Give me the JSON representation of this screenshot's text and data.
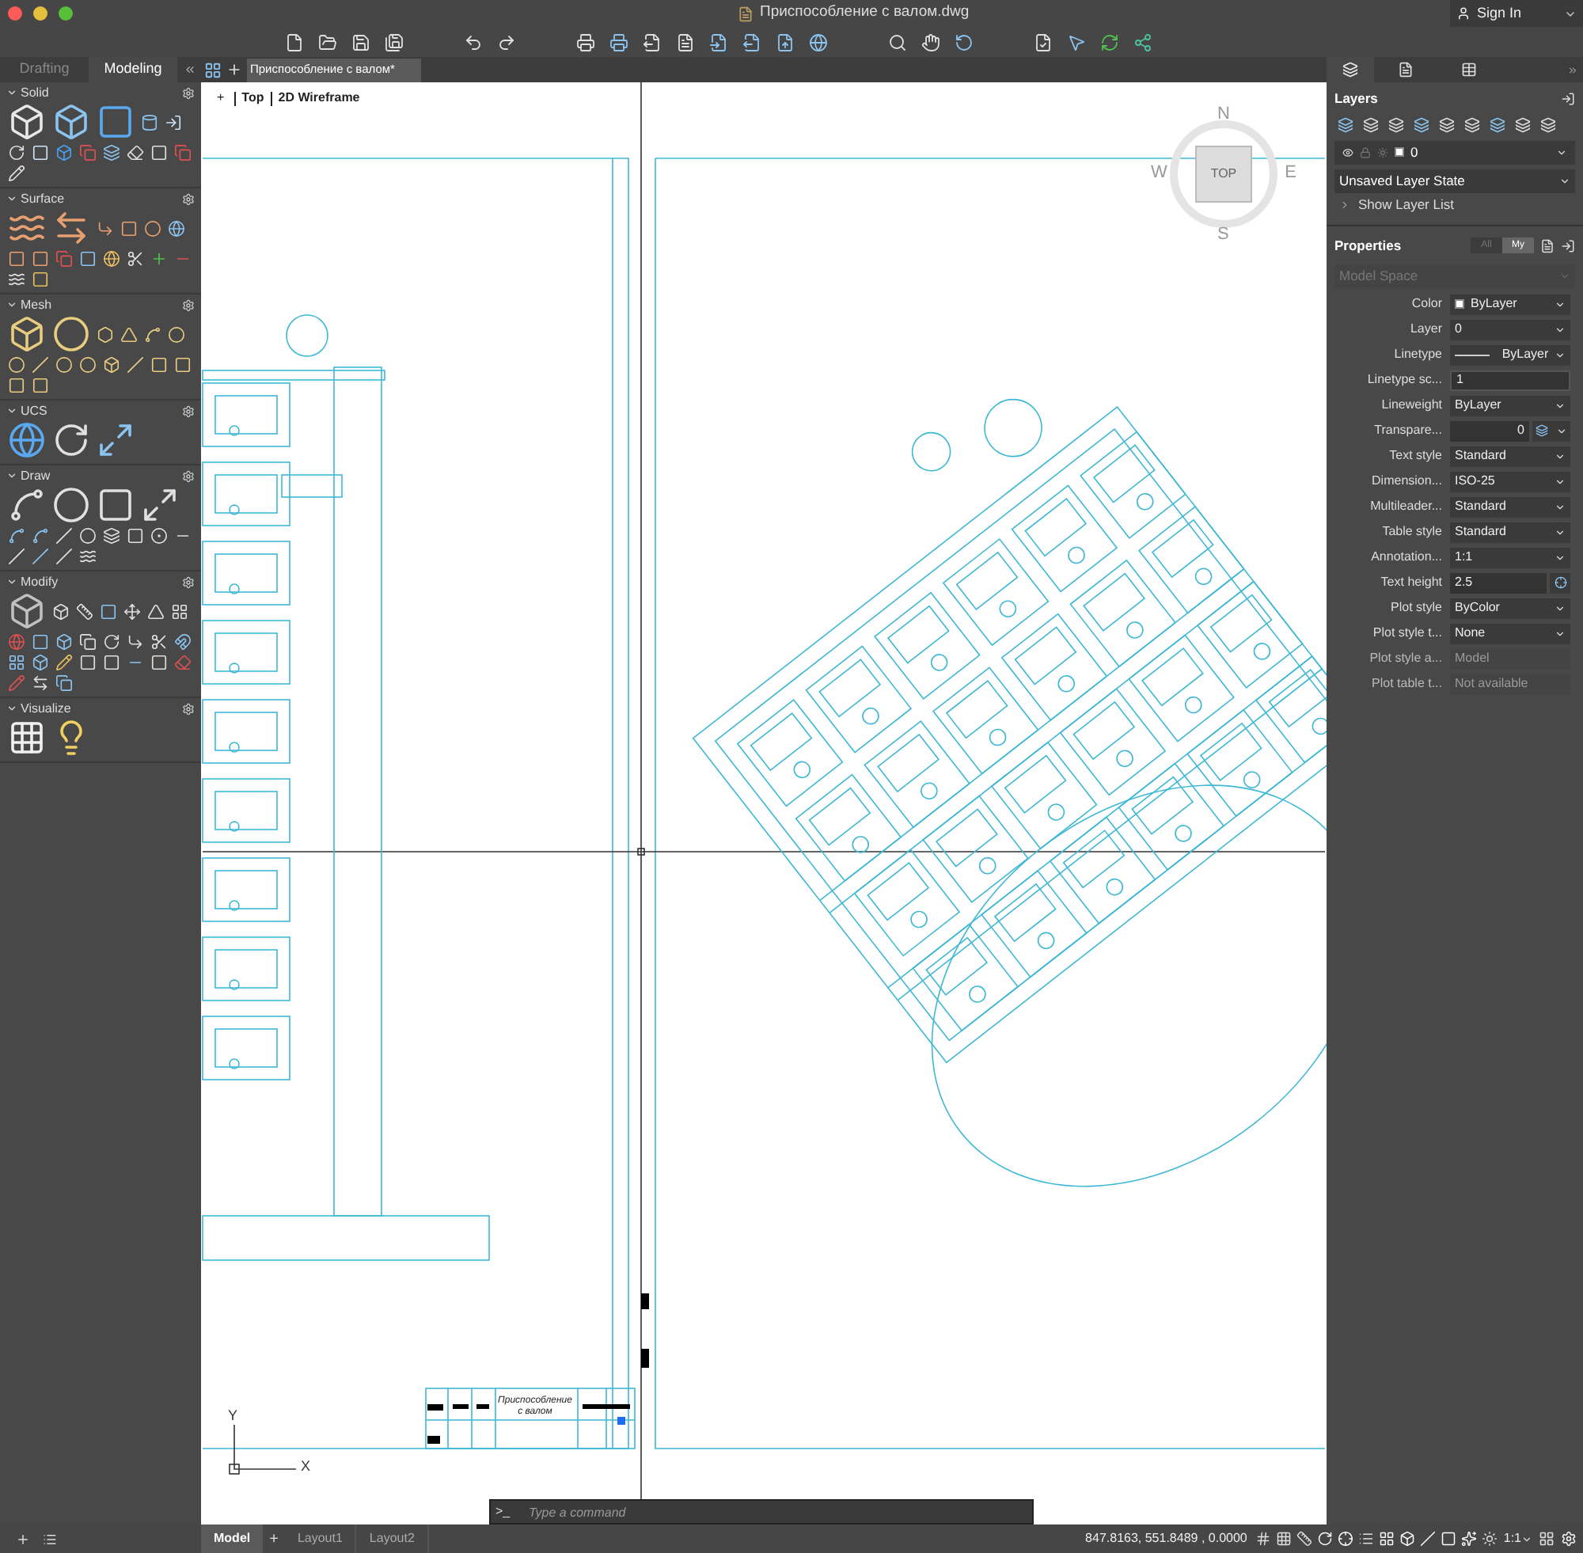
{
  "title_bar": {
    "title": "Приспособление с валом.dwg",
    "sign_in": "Sign In"
  },
  "workspace_tabs": [
    {
      "label": "Drafting",
      "selected": false
    },
    {
      "label": "Modeling",
      "selected": true
    }
  ],
  "palette": [
    {
      "title": "Solid"
    },
    {
      "title": "Surface"
    },
    {
      "title": "Mesh"
    },
    {
      "title": "UCS"
    },
    {
      "title": "Draw"
    },
    {
      "title": "Modify"
    },
    {
      "title": "Visualize"
    }
  ],
  "document_tabs": [
    {
      "label": "Приспособление с валом*",
      "selected": true
    }
  ],
  "viewport": {
    "controls": [
      "+",
      "Top",
      "2D Wireframe"
    ],
    "viewcube": {
      "north": "N",
      "south": "S",
      "east": "E",
      "west": "W",
      "face": "TOP"
    },
    "ucs": {
      "x": "X",
      "y": "Y"
    },
    "title_block": "Приспособление с валом"
  },
  "command_line": {
    "prompt": ">_",
    "placeholder": "Type a command"
  },
  "layout_tabs": [
    {
      "label": "Model",
      "selected": true
    },
    {
      "label": "Layout1",
      "selected": false
    },
    {
      "label": "Layout2",
      "selected": false
    }
  ],
  "add_layout": "+",
  "coordinates": "847.8163, 551.8489 , 0.0000",
  "annotation_scale": "1:1",
  "layers": {
    "title": "Layers",
    "current_layer": "0",
    "layer_state": "Unsaved Layer State",
    "show_list": "Show Layer List",
    "expanded": false
  },
  "properties": {
    "title": "Properties",
    "filters": [
      {
        "label": "All",
        "selected": false
      },
      {
        "label": "My",
        "selected": true
      }
    ],
    "selection": "Model Space",
    "rows": [
      {
        "label": "Color",
        "value": "ByLayer",
        "kind": "swatch"
      },
      {
        "label": "Layer",
        "value": "0",
        "kind": "dropdown"
      },
      {
        "label": "Linetype",
        "value": "ByLayer",
        "kind": "linetype"
      },
      {
        "label": "Linetype sc...",
        "value": "1",
        "kind": "input"
      },
      {
        "label": "Lineweight",
        "value": "ByLayer",
        "kind": "dropdown"
      },
      {
        "label": "Transpare...",
        "value": "0",
        "kind": "transparency"
      },
      {
        "label": "Text style",
        "value": "Standard",
        "kind": "dropdown"
      },
      {
        "label": "Dimension...",
        "value": "ISO-25",
        "kind": "dropdown"
      },
      {
        "label": "Multileader...",
        "value": "Standard",
        "kind": "dropdown"
      },
      {
        "label": "Table style",
        "value": "Standard",
        "kind": "dropdown"
      },
      {
        "label": "Annotation...",
        "value": "1:1",
        "kind": "dropdown"
      },
      {
        "label": "Text height",
        "value": "2.5",
        "kind": "pick"
      },
      {
        "label": "Plot style",
        "value": "ByColor",
        "kind": "dropdown"
      },
      {
        "label": "Plot style t...",
        "value": "None",
        "kind": "dropdown"
      },
      {
        "label": "Plot style a...",
        "value": "Model",
        "kind": "disabled"
      },
      {
        "label": "Plot table t...",
        "value": "Not available",
        "kind": "disabled"
      }
    ]
  }
}
